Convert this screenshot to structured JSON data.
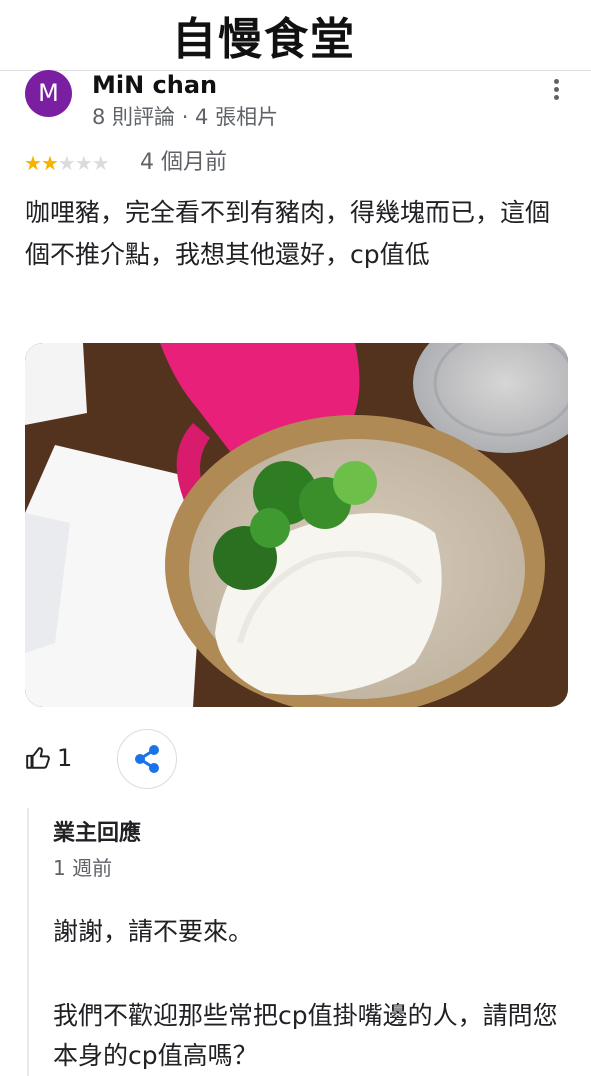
{
  "header": {
    "title": "自慢食堂"
  },
  "review": {
    "avatar_initial": "M",
    "author": "MiN chan",
    "author_meta": "8 則評論 · 4 張相片",
    "rating": 2,
    "rating_max": 5,
    "time": "4 個月前",
    "text": "咖哩豬，完全看不到有豬肉，得幾塊而已，這個個不推介點，我想其他還好，cp值低",
    "likes": "1"
  },
  "owner_reply": {
    "title": "業主回應",
    "time": "1 週前",
    "line1": "謝謝，請不要來。",
    "line2": "我們不歡迎那些常把cp值掛嘴邊的人，請問您本身的cp值高嗎？"
  },
  "colors": {
    "avatar": "#7b1fa2",
    "star": "#f6b400",
    "star_empty": "#dadce0",
    "share": "#1a73e8"
  },
  "icons": [
    "more-vert-icon",
    "thumb-up-icon",
    "share-icon"
  ]
}
